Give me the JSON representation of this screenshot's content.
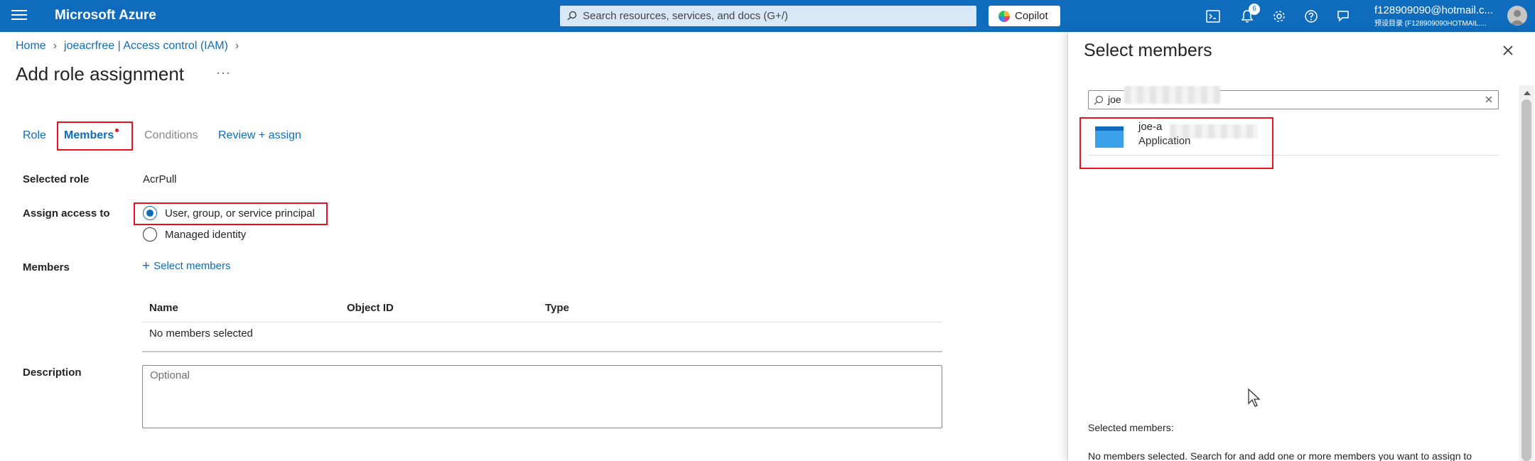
{
  "topbar": {
    "brand": "Microsoft Azure",
    "search_placeholder": "Search resources, services, and docs (G+/)",
    "copilot_label": "Copilot",
    "notifications_count": "6",
    "account_email": "f128909090@hotmail.c...",
    "account_directory": "预设目录 (F128909090HOTMAIL...."
  },
  "breadcrumb": {
    "items": [
      "Home",
      "joeacrfree | Access control (IAM)"
    ]
  },
  "page": {
    "title": "Add role assignment",
    "more": "···"
  },
  "tabs": [
    {
      "label": "Role"
    },
    {
      "label": "Members"
    },
    {
      "label": "Conditions"
    },
    {
      "label": "Review + assign"
    }
  ],
  "form": {
    "selected_role_label": "Selected role",
    "selected_role_value": "AcrPull",
    "assign_access_label": "Assign access to",
    "assign_options": [
      "User, group, or service principal",
      "Managed identity"
    ],
    "members_label": "Members",
    "select_members_link": "Select members",
    "table_columns": [
      "Name",
      "Object ID",
      "Type"
    ],
    "table_empty": "No members selected",
    "description_label": "Description",
    "description_placeholder": "Optional"
  },
  "panel": {
    "title": "Select members",
    "search_value": "joe",
    "result": {
      "name": "joe-a",
      "type": "Application"
    },
    "selected_members_label": "Selected members:",
    "no_members_text": "No members selected. Search for and add one or more members you want to assign to"
  },
  "colors": {
    "azure_blue": "#0f6cbd",
    "highlight_red": "#e81123"
  }
}
